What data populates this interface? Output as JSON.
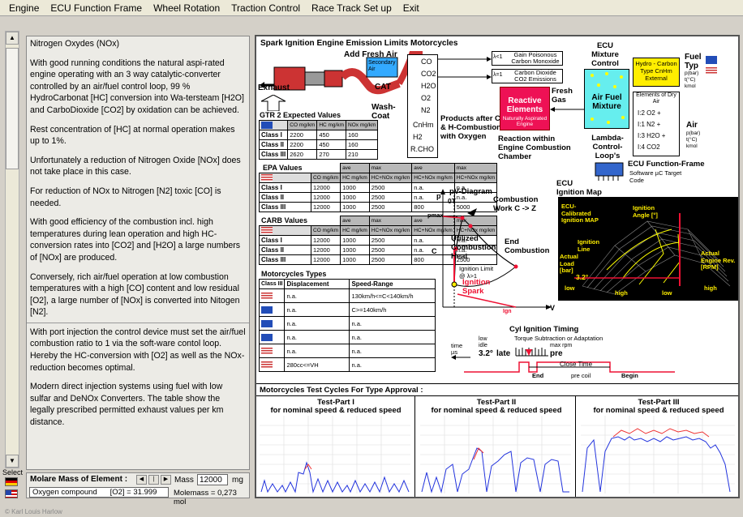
{
  "menu": [
    "Engine",
    "ECU Function Frame",
    "Wheel Rotation",
    "Traction Control",
    "Race Track Set up",
    "Exit"
  ],
  "sidebar": {
    "select_label": "Select"
  },
  "text_panel": {
    "paragraphs_top": [
      "Nitrogen Oxydes (NOx)",
      "With good running conditions the natural aspi-rated engine operating with an 3 way catalytic-converter controlled by an air/fuel control loop, 99 % HydroCarbonat [HC] conversion into Wa-tersteam [H2O] and CarboDioxide [CO2] by oxidation can be achieved.",
      "Rest concentration of [HC] at normal operation makes up to 1%.",
      "Unfortunately a reduction of Nitrogen Oxide [NOx] does not take place in this case.",
      "For reduction of NOx to Nitrogen [N2] toxic [CO] is needed.",
      "With good efficiency of the combustion incl. high temperatures during lean operation and high HC-conversion rates into [CO2] and [H2O] a large numbers of [NOx] are produced.",
      "Conversely, rich air/fuel operation at low combustion temperatures with a high [CO] content and low residual [O2], a large number of [NOx] is converted into Nitogen [N2]."
    ],
    "paragraphs_bottom": [
      "With port injection the control device must set the air/fuel combustion ratio to 1 via the soft-ware contol loop. Hereby the HC-conversion with [O2] as well as the NOx-reduction becomes optimal.",
      "Modern direct injection systems using fuel with low sulfar and DeNOx Converters. The table show the legally prescribed permitted exhaust values per km distance."
    ]
  },
  "molar": {
    "title": "Molare Mass of Element :",
    "mass_label": "Mass",
    "mass_value": "12000",
    "mass_unit": "mg",
    "compound": "Oxygen compound      [O2] = 31.999",
    "molemass": "Molemass = 0,273  mol"
  },
  "footer": "© Karl Louis Harlow",
  "diagram": {
    "title": "Spark Ignition Engine Emission Limits Motorcycles",
    "add_fresh_air": "Add Fresh Air",
    "secondary_air": "Secondary Air",
    "exhaust": "Exhaust",
    "cat": "CAT",
    "wash_coat": "Wash-Coat",
    "species": [
      "CO",
      "CO2",
      "H2O",
      "O2",
      "N2",
      "CnHm",
      "H2",
      "R.CHO"
    ],
    "lambda1": "λ<1",
    "gain_co": "Gain Poisonous Carbon Monoxide",
    "lambda2": "λ=1",
    "gain_co2": "Carbon Dioxide CO2 Emissions",
    "products_after": "Products after C- & H-Combustion with Oxygen",
    "reactive_elements": "Reactive Elements",
    "naturally_aspirated": "Naturally Aspirated Engine",
    "fresh_gas": "Fresh Gas",
    "reaction_within": "Reaction within Engine Combustion Chamber",
    "ecu_mixture": "ECU Mixture Control",
    "air_fuel_mixture": "Air Fuel Mixture",
    "lambda_loops": "Lambda-Control-Loop's",
    "hydro_carbon": "Hydro - Carbon Type CnHm External",
    "elements_dry_air": "Elements of Dry Air",
    "dry_air_list": [
      "I:2 O2  +",
      "I:1 N2  +",
      "I:3 H2O +",
      "I:4 CO2"
    ],
    "fuel_typ": "Fuel Typ",
    "fuel_units": "p(bar) t(°C) kmol",
    "air": "Air",
    "air_units": "p(bar) t(°C) kmol",
    "ecu_frame": "ECU Function-Frame",
    "ecu_frame_sub": "Software µC Target Code",
    "ecu_ignition_map": "ECU Ignition Map",
    "pv_title": "pV-Diagram",
    "pv_ot": "0T",
    "pv_p": "p",
    "pv_pmax": "pmax",
    "pv_c": "C",
    "pv_v": "V",
    "pv_ign": "Ign",
    "combustion_work": "Combustion Work C -> Z",
    "utilized_heat": "Utilized Combustion Heat",
    "end_combustion": "End Combustion",
    "ignition_limit": "Ignition Limit @ λ>1",
    "ignition_spark": "Ignition Spark",
    "map_labels": {
      "ecu_calibrated": "ECU-Calibrated Ignition MAP",
      "ignition_angle": "Ignition Angle [°]",
      "ignition_line": "Ignition Line",
      "actual_load": "Actual Load [bar]",
      "actual_rev": "Actual Engine Rev. [RPM]",
      "value": "3.2°",
      "low1": "low",
      "high1": "high",
      "low2": "low",
      "high2": "high"
    },
    "cyl_timing": "Cyl Ignition Timing",
    "torque_sub": "Torque Subtraction or Adaptation",
    "timing": {
      "time": "time µs",
      "low_idle": "low idle",
      "value": "3.2°",
      "late": "late",
      "max_rpm": "max rpm",
      "pre": "pre",
      "close_time": "Close Time",
      "end": "End",
      "pre_coil": "pre coil",
      "begin": "Begin"
    },
    "gtr2": {
      "title": "GTR 2 Expected Values",
      "headers": [
        "",
        "CO mg/km",
        "HC mg/km",
        "NOx mg/km"
      ],
      "rows": [
        [
          "Class I",
          "2200",
          "450",
          "160"
        ],
        [
          "Class II",
          "2200",
          "450",
          "160"
        ],
        [
          "Class III",
          "2620",
          "270",
          "210"
        ]
      ]
    },
    "epa": {
      "title": "EPA Values",
      "sub": [
        "ave",
        "max",
        "ave",
        "max"
      ],
      "headers": [
        "",
        "CO mg/km",
        "HC mg/km",
        "HC+NOx mg/km",
        "HC+NOx mg/km"
      ],
      "rows": [
        [
          "Class I",
          "12000",
          "1000",
          "2500",
          "n.a.",
          "n.a."
        ],
        [
          "Class II",
          "12000",
          "1000",
          "2500",
          "n.a.",
          "n.a."
        ],
        [
          "Class III",
          "12000",
          "1000",
          "2500",
          "800",
          "5000"
        ]
      ]
    },
    "carb": {
      "title": "CARB Values",
      "sub": [
        "ave",
        "max",
        "ave",
        "max"
      ],
      "headers": [
        "",
        "CO mg/km",
        "HC mg/km",
        "HC+NOx mg/km",
        "HC+NOx mg/km"
      ],
      "rows": [
        [
          "Class I",
          "12000",
          "1000",
          "2500",
          "n.a.",
          "n.a."
        ],
        [
          "Class II",
          "12000",
          "1000",
          "2500",
          "n.a.",
          "n.a."
        ],
        [
          "Class III",
          "12000",
          "1000",
          "2500",
          "800",
          "2500"
        ]
      ]
    },
    "moto_types": {
      "title": "Motorcycles Types",
      "headers": [
        "Class III",
        "Displacement",
        "Speed-Range"
      ],
      "rows": [
        [
          "n.a.",
          "130km/h<=C<140km/h"
        ],
        [
          "n.a.",
          "C>=140km/h"
        ],
        [
          "n.a.",
          "n.a."
        ],
        [
          "n.a.",
          "n.a."
        ],
        [
          "n.a.",
          "n.a."
        ],
        [
          "280cc<=VH",
          "n.a."
        ]
      ]
    },
    "cycles_title": "Motorcycles Test Cycles For Type Approval :",
    "cycles": [
      {
        "title": "Test-Part I",
        "sub": "for nominal speed & reduced speed"
      },
      {
        "title": "Test-Part II",
        "sub": "for nominal speed & reduced speed"
      },
      {
        "title": "Test-Part III",
        "sub": "for nominal speed & reduced speed"
      }
    ]
  },
  "colors": {
    "accent_red": "#ee1155",
    "yellow": "#ffee00",
    "cyan": "#66eeee",
    "eu_blue": "#224db8"
  }
}
